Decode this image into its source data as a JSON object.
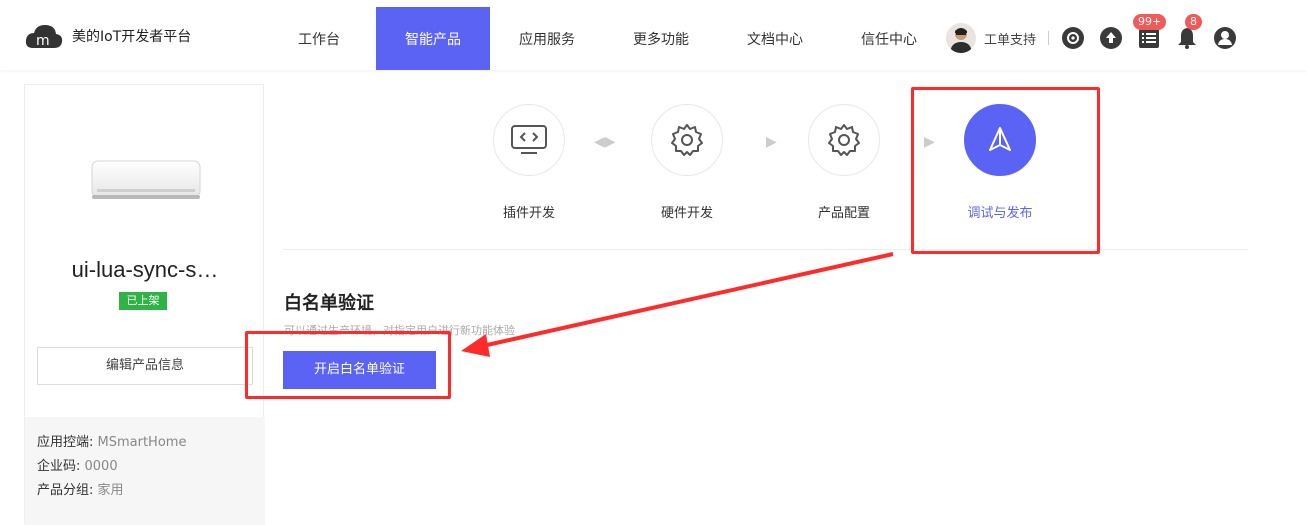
{
  "header": {
    "logo_text": "美的IoT开发者平台",
    "nav": [
      {
        "label": "工作台",
        "active": false
      },
      {
        "label": "智能产品",
        "active": true
      },
      {
        "label": "应用服务",
        "active": false
      },
      {
        "label": "更多功能",
        "active": false
      },
      {
        "label": "文档中心",
        "active": false
      },
      {
        "label": "信任中心",
        "active": false
      }
    ],
    "support_label": "工单支持",
    "badge_list": "99+",
    "badge_bell": "8",
    "icons": [
      "refresh-circle-icon",
      "upload-circle-icon",
      "list-icon",
      "bell-icon",
      "user-icon"
    ]
  },
  "product": {
    "name": "ui-lua-sync-s…",
    "status": "已上架",
    "edit_button": "编辑产品信息",
    "meta": [
      {
        "label": "应用控端: ",
        "value": "MSmartHome"
      },
      {
        "label": "企业码: ",
        "value": "0000"
      },
      {
        "label": "产品分组: ",
        "value": "家用"
      }
    ]
  },
  "steps": [
    {
      "label": "插件开发",
      "icon": "code-monitor-icon",
      "active": false
    },
    {
      "label": "硬件开发",
      "icon": "gear-icon",
      "active": false
    },
    {
      "label": "产品配置",
      "icon": "gear-icon",
      "active": false
    },
    {
      "label": "调试与发布",
      "icon": "paper-plane-icon",
      "active": true
    }
  ],
  "whitelist": {
    "title": "白名单验证",
    "description": "可以通过生产环境，对指定用户进行新功能体验",
    "button": "开启白名单验证"
  },
  "colors": {
    "primary": "#5b63f5",
    "status_green": "#2fb344",
    "annotation_red": "#ff2b2b",
    "badge_red": "#f25a5a"
  }
}
